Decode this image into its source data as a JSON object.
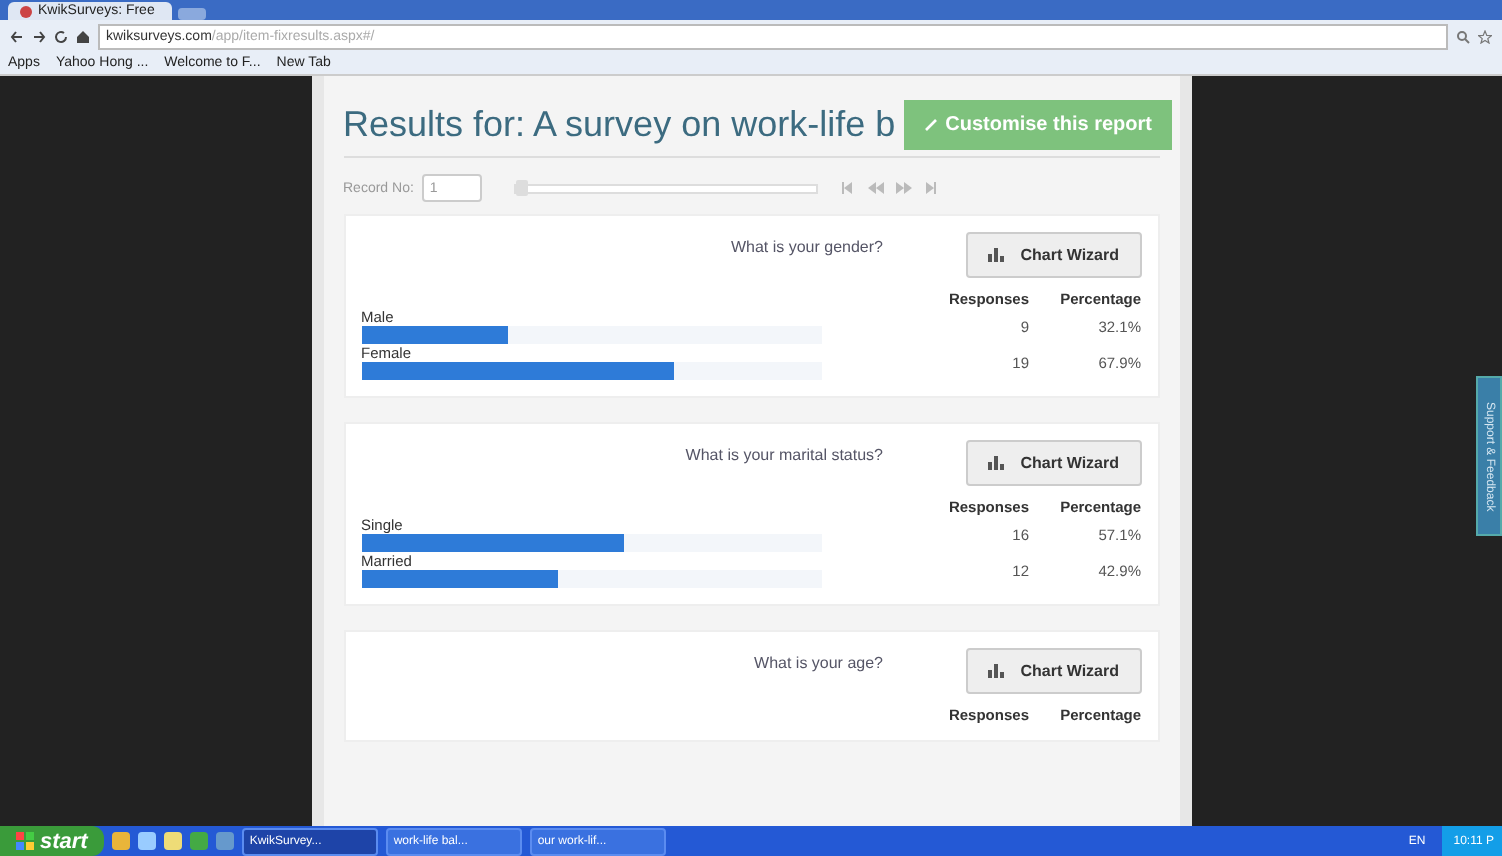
{
  "browser": {
    "tabs": [
      {
        "title": "KwikSurveys: Free",
        "selected": true
      }
    ],
    "address_host": "kwiksurveys.com",
    "address_path": "/app/item-fixresults.aspx#/",
    "bookmarks": [
      "Apps",
      "Yahoo Hong ...",
      "Welcome to F...",
      "New Tab"
    ]
  },
  "page": {
    "title": "Results for: A survey on work-life b",
    "customise_button": "Customise this report",
    "record_label": "Record No:",
    "record_value": "1",
    "record_slider": {
      "level": 0
    },
    "questions": [
      {
        "question": "What is your gender?",
        "button": "Chart Wizard",
        "headers": [
          "Responses",
          "Percentage"
        ],
        "answers": [
          {
            "label": "Male",
            "level": 0.321,
            "responses": "9",
            "percentage": "32.1%"
          },
          {
            "label": "Female",
            "level": 0.679,
            "responses": "19",
            "percentage": "67.9%"
          }
        ]
      },
      {
        "question": "What is your marital status?",
        "button": "Chart Wizard",
        "headers": [
          "Responses",
          "Percentage"
        ],
        "answers": [
          {
            "label": "Single",
            "level": 0.571,
            "responses": "16",
            "percentage": "57.1%"
          },
          {
            "label": "Married",
            "level": 0.429,
            "responses": "12",
            "percentage": "42.9%"
          }
        ]
      },
      {
        "question": "What is your age?",
        "button": "Chart Wizard",
        "headers": [
          "Responses",
          "Percentage"
        ]
      }
    ]
  },
  "support_tab": "Support & Feedback",
  "taskbar": {
    "start": "start",
    "windows": [
      {
        "title": "KwikSurvey...",
        "selected": true
      },
      {
        "title": "work-life bal...",
        "selected": false
      },
      {
        "title": "our work-lif...",
        "selected": false
      }
    ],
    "language": "EN",
    "clock": "10:11 P"
  }
}
